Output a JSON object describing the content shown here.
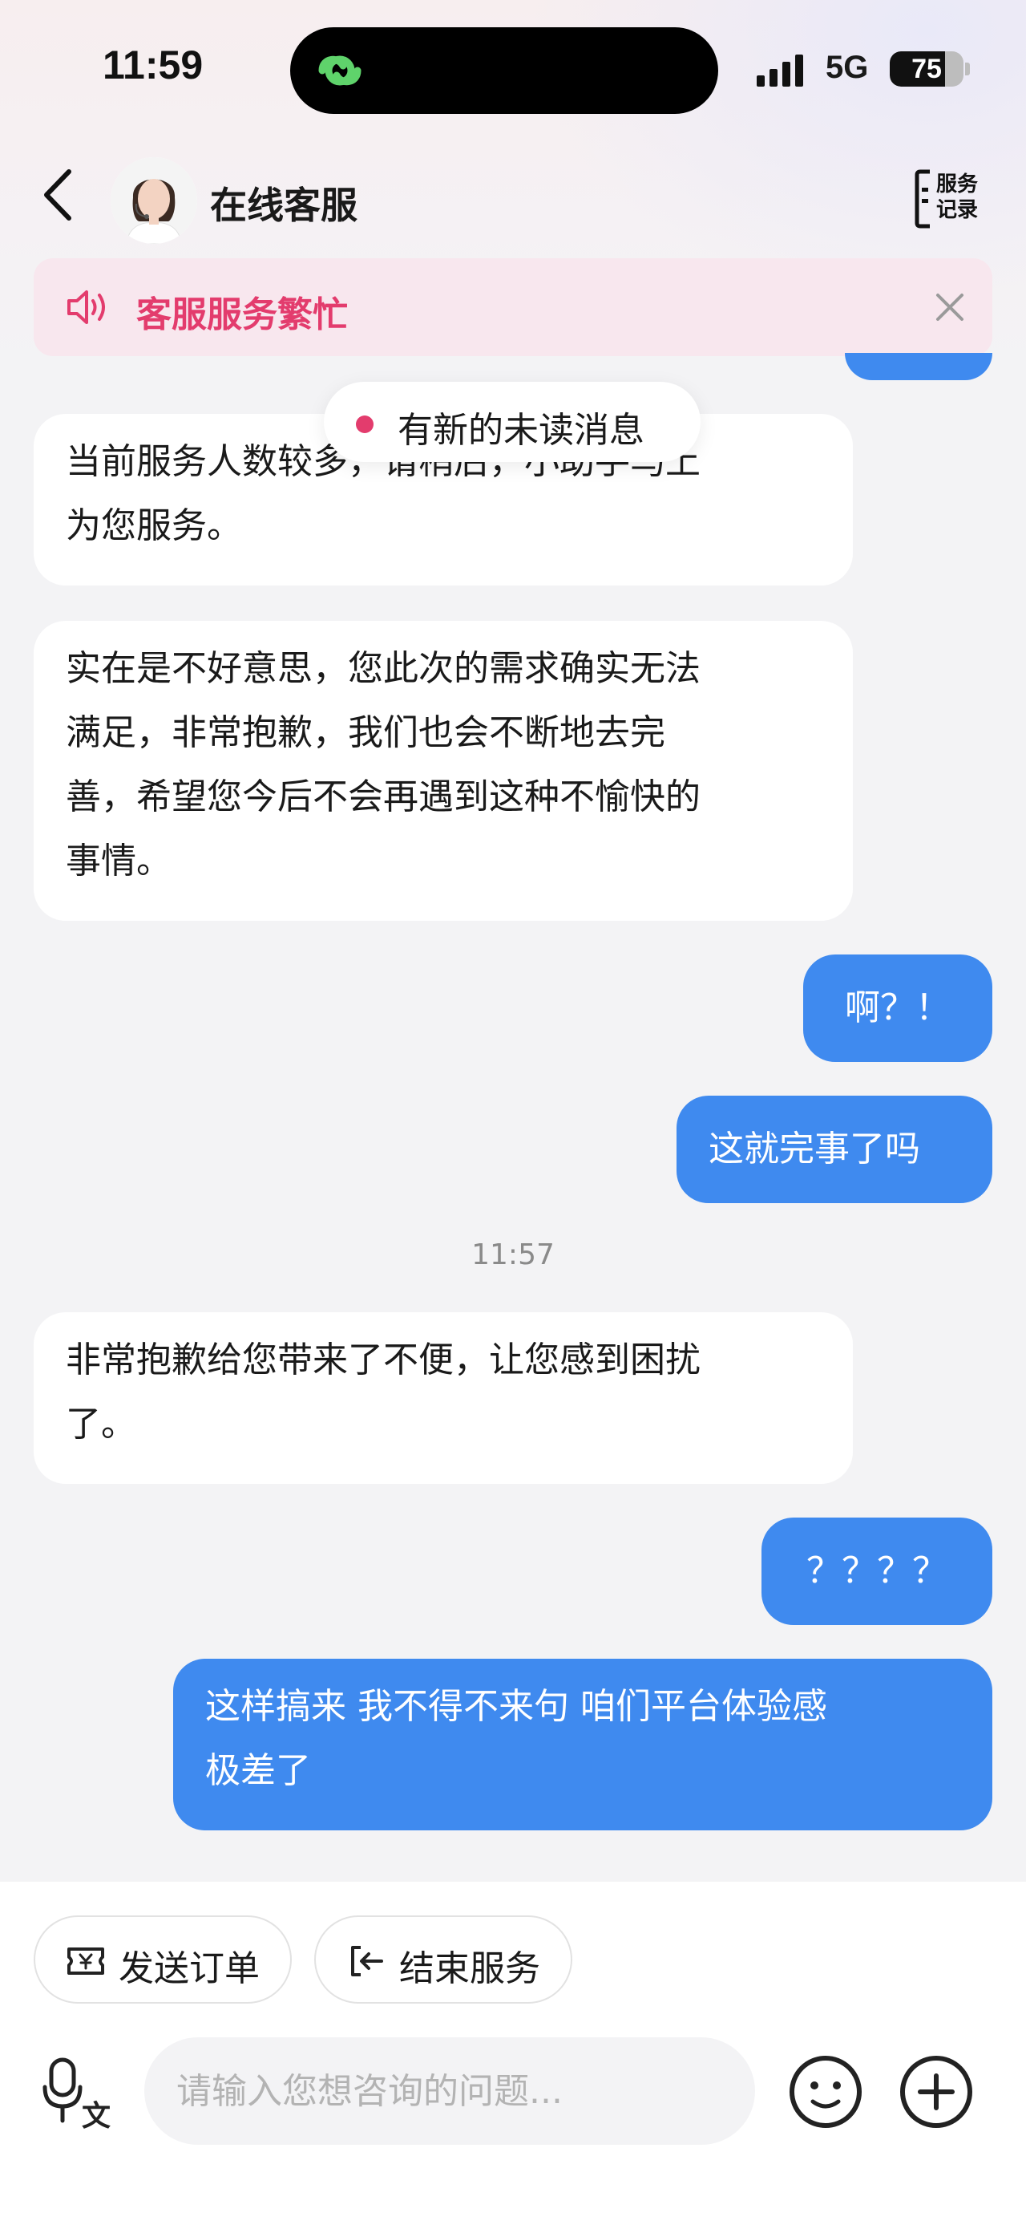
{
  "status_bar": {
    "time": "11:59",
    "network": "5G",
    "battery": "75",
    "battery_level": 0.75
  },
  "header": {
    "title": "在线客服",
    "record_label_line1": "服务",
    "record_label_line2": "记录"
  },
  "banner": {
    "text": "客服服务繁忙",
    "accent_color": "#e33c6d"
  },
  "unread": {
    "text": "有新的未读消息"
  },
  "messages": [
    {
      "side": "in",
      "line1": "当前服务人数较多，请稍后，小助手马上",
      "line2": "为您服务。"
    },
    {
      "side": "in",
      "line1": "实在是不好意思，您此次的需求确实无法",
      "line2": "满足，非常抱歉，我们也会不断地去完",
      "line3": "善，希望您今后不会再遇到这种不愉快的",
      "line4": "事情。"
    },
    {
      "side": "out",
      "text": "啊？！"
    },
    {
      "side": "out",
      "text": "这就完事了吗"
    },
    {
      "side": "in",
      "line1": "非常抱歉给您带来了不便，让您感到困扰",
      "line2": "了。"
    },
    {
      "side": "out",
      "text": "？？？？"
    },
    {
      "side": "out",
      "line1": "这样搞来 我不得不来句 咱们平台体验感",
      "line2": "极差了"
    }
  ],
  "timestamp": "11:57",
  "quick_actions": {
    "send_order": "发送订单",
    "end_service": "结束服务"
  },
  "input": {
    "placeholder": "请输入您想咨询的问题...",
    "value": ""
  },
  "colors": {
    "outgoing_bubble": "#3f8aef",
    "incoming_bubble": "#ffffff",
    "background": "#f3f3f5"
  }
}
